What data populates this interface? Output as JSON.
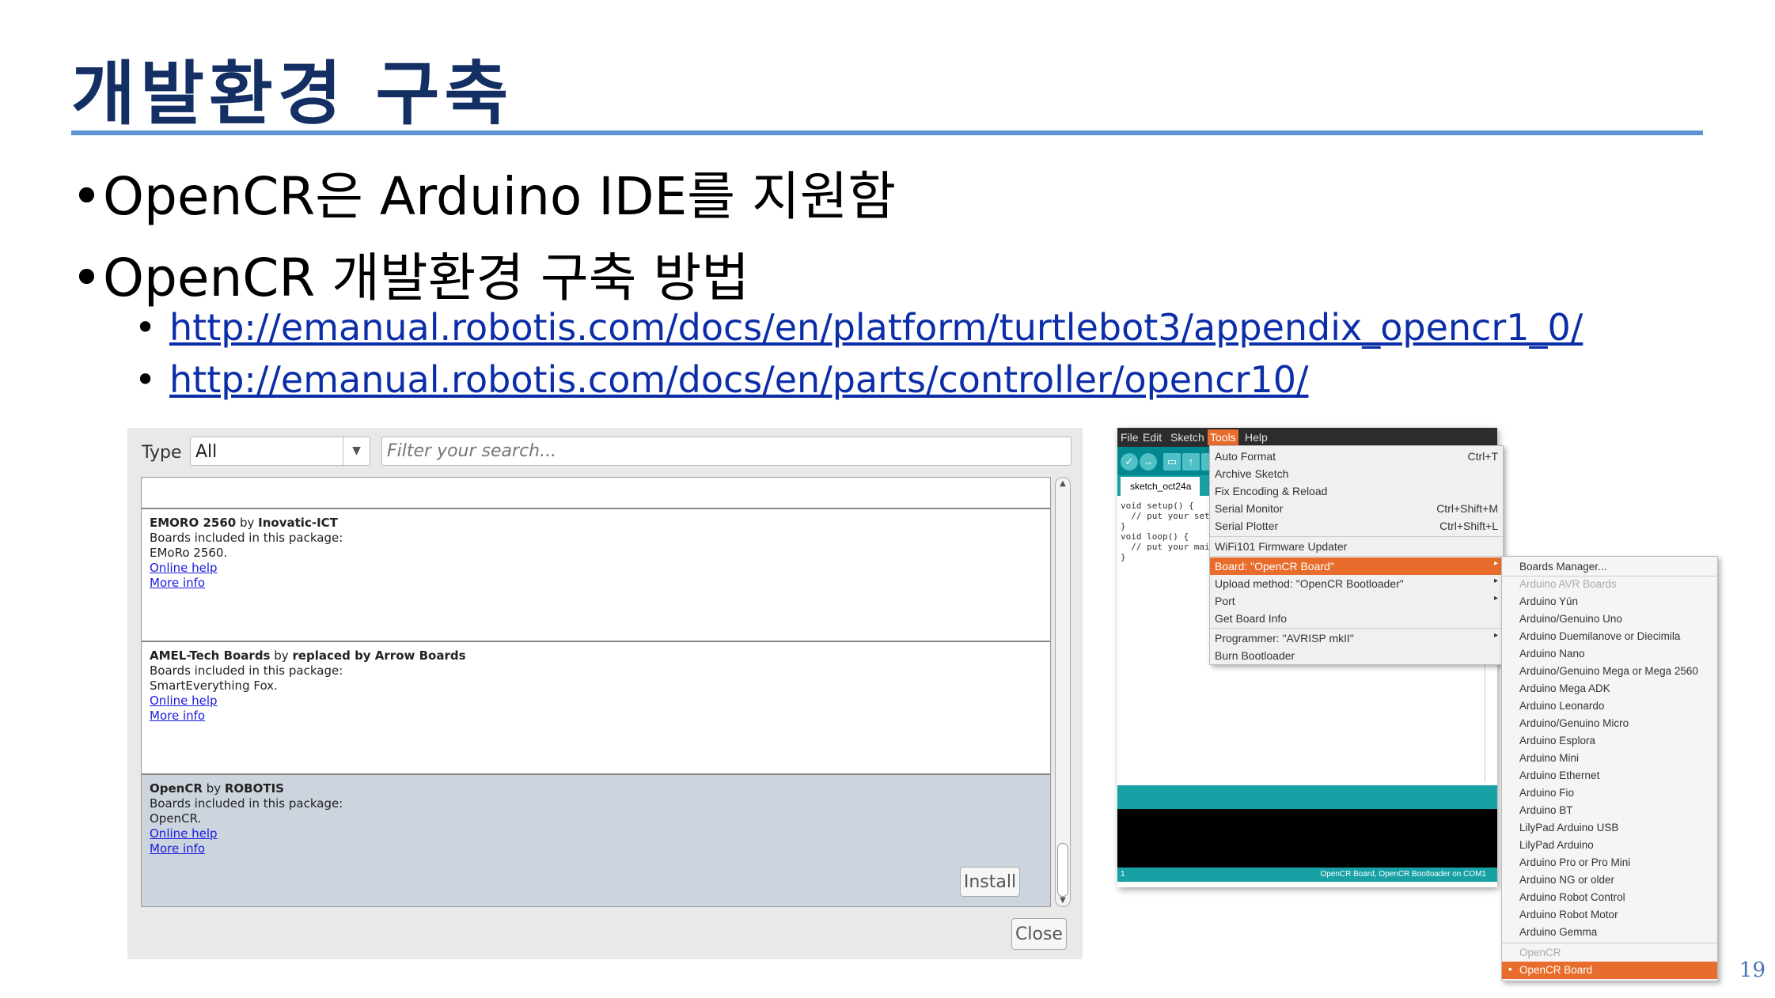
{
  "slide": {
    "title": "개발환경 구축",
    "bullets": [
      "OpenCR은 Arduino IDE를 지원함",
      "OpenCR 개발환경 구축 방법"
    ],
    "links": [
      "http://emanual.robotis.com/docs/en/platform/turtlebot3/appendix_opencr1_0/",
      "http://emanual.robotis.com/docs/en/parts/controller/opencr10/"
    ],
    "page_number": "19",
    "accent_color": "#132f63",
    "rule_color": "#5b95d3"
  },
  "boards_manager": {
    "type_label": "Type",
    "type_value": "All",
    "filter_placeholder": "Filter your search...",
    "items": [
      {
        "name": "EMORO 2560",
        "by": "by",
        "author": "Inovatic-ICT",
        "included_label": "Boards included in this package:",
        "boards": "EMoRo 2560.",
        "online_help": "Online help",
        "more_info": "More info"
      },
      {
        "name": "AMEL-Tech Boards",
        "by": "by",
        "author": "replaced by Arrow Boards",
        "included_label": "Boards included in this package:",
        "boards": "SmartEverything Fox.",
        "online_help": "Online help",
        "more_info": "More info"
      },
      {
        "name": "OpenCR",
        "by": "by",
        "author": "ROBOTIS",
        "included_label": "Boards included in this package:",
        "boards": "OpenCR.",
        "online_help": "Online help",
        "more_info": "More info"
      }
    ],
    "install_label": "Install",
    "close_label": "Close"
  },
  "ide": {
    "menubar": [
      "File",
      "Edit",
      "Sketch",
      "Tools",
      "Help"
    ],
    "active_menu": "Tools",
    "tab_name": "sketch_oct24a",
    "code_lines": [
      "void setup() {",
      "  // put your set",
      "",
      "}",
      "",
      "void loop() {",
      "  // put your mai",
      "",
      "}"
    ],
    "status_line": "1",
    "status_board": "OpenCR Board, OpenCR Bootloader on COM1",
    "tools_menu": [
      {
        "label": "Auto Format",
        "shortcut": "Ctrl+T"
      },
      {
        "label": "Archive Sketch",
        "shortcut": ""
      },
      {
        "label": "Fix Encoding & Reload",
        "shortcut": ""
      },
      {
        "label": "Serial Monitor",
        "shortcut": "Ctrl+Shift+M"
      },
      {
        "label": "Serial Plotter",
        "shortcut": "Ctrl+Shift+L"
      },
      {
        "label": "WiFi101 Firmware Updater",
        "shortcut": ""
      },
      {
        "label": "Board: \"OpenCR Board\"",
        "shortcut": ""
      },
      {
        "label": "Upload method: \"OpenCR Bootloader\"",
        "shortcut": ""
      },
      {
        "label": "Port",
        "shortcut": ""
      },
      {
        "label": "Get Board Info",
        "shortcut": ""
      },
      {
        "label": "Programmer: \"AVRISP mkII\"",
        "shortcut": ""
      },
      {
        "label": "Burn Bootloader",
        "shortcut": ""
      }
    ],
    "boards_submenu": [
      "Boards Manager...",
      "Arduino AVR Boards",
      "Arduino Yún",
      "Arduino/Genuino Uno",
      "Arduino Duemilanove or Diecimila",
      "Arduino Nano",
      "Arduino/Genuino Mega or Mega 2560",
      "Arduino Mega ADK",
      "Arduino Leonardo",
      "Arduino/Genuino Micro",
      "Arduino Esplora",
      "Arduino Mini",
      "Arduino Ethernet",
      "Arduino Fio",
      "Arduino BT",
      "LilyPad Arduino USB",
      "LilyPad Arduino",
      "Arduino Pro or Pro Mini",
      "Arduino NG or older",
      "Arduino Robot Control",
      "Arduino Robot Motor",
      "Arduino Gemma",
      "OpenCR",
      "OpenCR Board"
    ],
    "highlight_color": "#e86c2c"
  }
}
